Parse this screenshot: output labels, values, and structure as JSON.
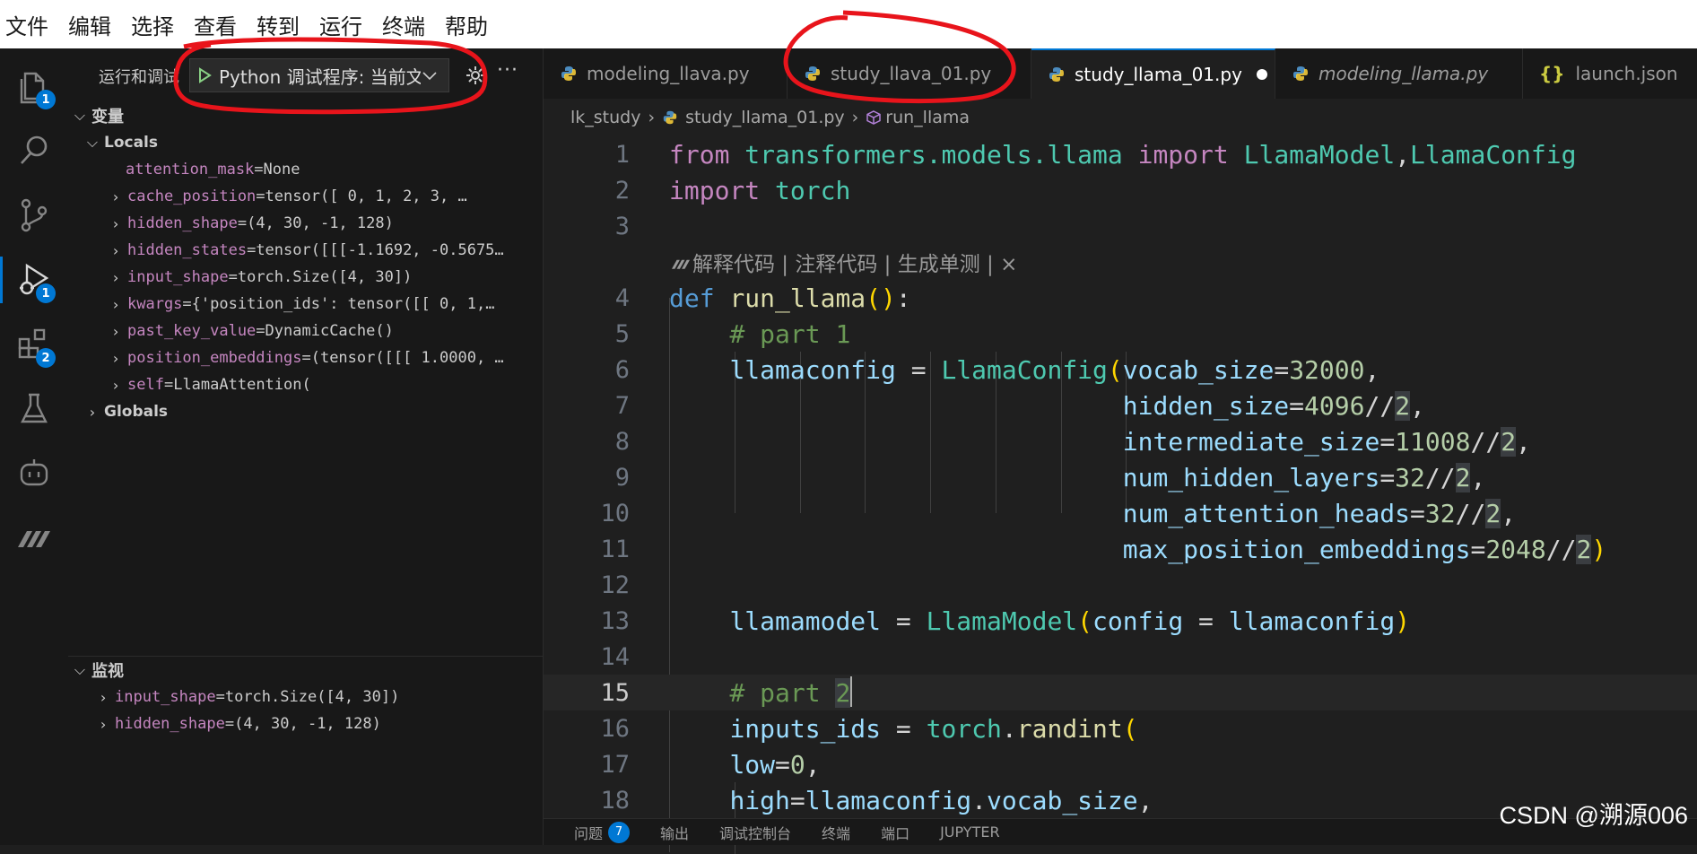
{
  "menubar": [
    "文件",
    "编辑",
    "选择",
    "查看",
    "转到",
    "运行",
    "终端",
    "帮助"
  ],
  "activity": {
    "explorer_badge": "1",
    "debug_badge": "1",
    "extensions_badge": "2"
  },
  "sidebar": {
    "title": "运行和调试",
    "launch_config": "Python 调试程序: 当前文件",
    "more": "···",
    "variables_header": "变量",
    "locals_header": "Locals",
    "locals": [
      {
        "name": "attention_mask",
        "value": "None",
        "expandable": false
      },
      {
        "name": "cache_position",
        "value": "tensor([ 0,  1,  2,  3,  …",
        "expandable": true
      },
      {
        "name": "hidden_shape",
        "value": "(4, 30, -1, 128)",
        "expandable": true
      },
      {
        "name": "hidden_states",
        "value": "tensor([[[-1.1692, -0.5675…",
        "expandable": true
      },
      {
        "name": "input_shape",
        "value": "torch.Size([4, 30])",
        "expandable": true
      },
      {
        "name": "kwargs",
        "value": "{'position_ids': tensor([[ 0,  1,…",
        "expandable": true
      },
      {
        "name": "past_key_value",
        "value": "DynamicCache()",
        "expandable": true
      },
      {
        "name": "position_embeddings",
        "value": "(tensor([[[ 1.0000, …",
        "expandable": true
      },
      {
        "name": "self",
        "value": "LlamaAttention(",
        "expandable": true
      }
    ],
    "globals_header": "Globals",
    "watch_header": "监视",
    "watch": [
      {
        "name": "input_shape",
        "value": "torch.Size([4, 30])"
      },
      {
        "name": "hidden_shape",
        "value": "(4, 30, -1, 128)"
      }
    ]
  },
  "tabs": [
    {
      "label": "modeling_llava.py",
      "active": false,
      "dirty": false,
      "italic": false,
      "icon": "python-icon"
    },
    {
      "label": "study_llava_01.py",
      "active": false,
      "dirty": false,
      "italic": false,
      "icon": "python-icon"
    },
    {
      "label": "study_llama_01.py",
      "active": true,
      "dirty": true,
      "italic": false,
      "icon": "python-icon"
    },
    {
      "label": "modeling_llama.py",
      "active": false,
      "dirty": false,
      "italic": true,
      "icon": "python-icon"
    },
    {
      "label": "launch.json",
      "active": false,
      "dirty": false,
      "italic": false,
      "icon": "json-icon"
    }
  ],
  "breadcrumb": {
    "folder": "lk_study",
    "file": "study_llama_01.py",
    "symbol": "run_llama"
  },
  "codelens": "解释代码 | 注释代码 | 生成单测 | ×",
  "code_lines": [
    {
      "n": "1",
      "text": "from transformers.models.llama import LlamaModel,LlamaConfig"
    },
    {
      "n": "2",
      "text": "import torch"
    },
    {
      "n": "3",
      "text": ""
    },
    {
      "n": "4",
      "text": "def run_llama():"
    },
    {
      "n": "5",
      "text": "    # part 1"
    },
    {
      "n": "6",
      "text": "    llamaconfig = LlamaConfig(vocab_size=32000,"
    },
    {
      "n": "7",
      "text": "                              hidden_size=4096//2,"
    },
    {
      "n": "8",
      "text": "                              intermediate_size=11008//2,"
    },
    {
      "n": "9",
      "text": "                              num_hidden_layers=32//2,"
    },
    {
      "n": "10",
      "text": "                              num_attention_heads=32//2,"
    },
    {
      "n": "11",
      "text": "                              max_position_embeddings=2048//2)"
    },
    {
      "n": "12",
      "text": ""
    },
    {
      "n": "13",
      "text": "    llamamodel = LlamaModel(config = llamaconfig)"
    },
    {
      "n": "14",
      "text": ""
    },
    {
      "n": "15",
      "text": "    # part 2"
    },
    {
      "n": "16",
      "text": "    inputs_ids = torch.randint("
    },
    {
      "n": "17",
      "text": "        low=0,"
    },
    {
      "n": "18",
      "text": "        high=llamaconfig.vocab_size,"
    }
  ],
  "current_line": "15",
  "panel_tabs": [
    "问题",
    "输出",
    "调试控制台",
    "终端",
    "端口",
    "JUPYTER"
  ],
  "problems_count": "7",
  "watermark": "CSDN @溯源006",
  "colors": {
    "accent": "#0078d4",
    "annotation": "#e8141b",
    "editor_bg": "#1f1f1f",
    "sidebar_bg": "#181818"
  }
}
